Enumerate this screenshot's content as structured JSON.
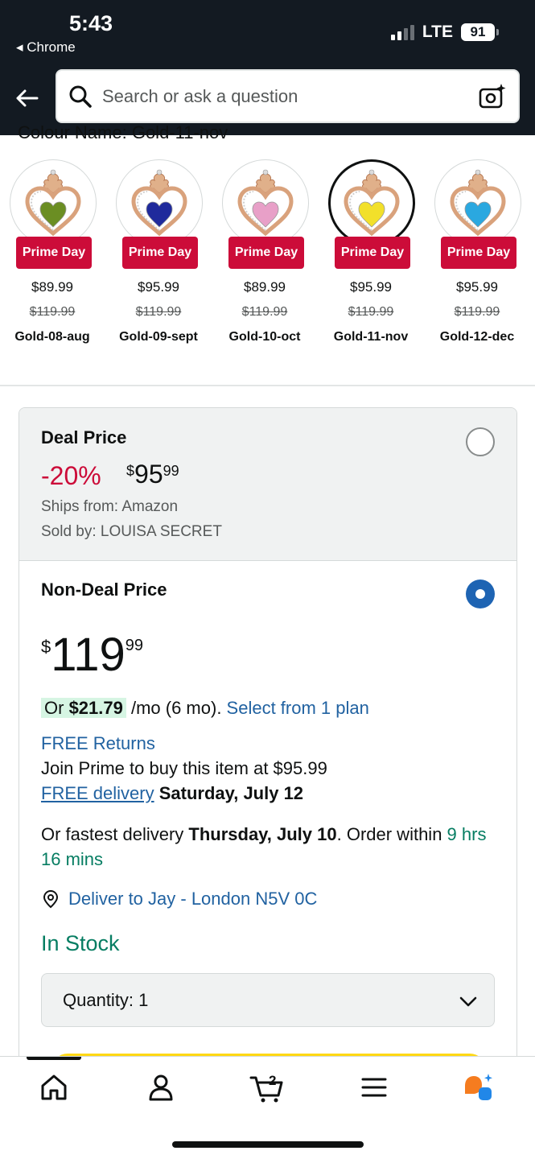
{
  "status_bar": {
    "time": "5:43",
    "back_app": "◂ Chrome",
    "network": "LTE",
    "battery": "91"
  },
  "search": {
    "placeholder": "Search or ask a question"
  },
  "colour_name_partial": "Colour Name: Gold-11-nov",
  "variants": [
    {
      "badge": "Prime Day",
      "price": "$89.99",
      "was": "$119.99",
      "name": "Gold-08-aug",
      "gem_color": "#6b8e23",
      "selected": false
    },
    {
      "badge": "Prime Day",
      "price": "$95.99",
      "was": "$119.99",
      "name": "Gold-09-sept",
      "gem_color": "#1f2a9c",
      "selected": false
    },
    {
      "badge": "Prime Day",
      "price": "$89.99",
      "was": "$119.99",
      "name": "Gold-10-oct",
      "gem_color": "#e8a0c8",
      "selected": false
    },
    {
      "badge": "Prime Day",
      "price": "$95.99",
      "was": "$119.99",
      "name": "Gold-11-nov",
      "gem_color": "#f2e02a",
      "selected": true
    },
    {
      "badge": "Prime Day",
      "price": "$95.99",
      "was": "$119.99",
      "name": "Gold-12-dec",
      "gem_color": "#2aa8e0",
      "selected": false
    }
  ],
  "deal": {
    "title": "Deal Price",
    "discount": "-20%",
    "currency": "$",
    "whole": "95",
    "fraction": "99",
    "ships_from": "Ships from: Amazon",
    "sold_by": "Sold by: LOUISA SECRET",
    "selected": false
  },
  "non_deal": {
    "title": "Non-Deal Price",
    "currency": "$",
    "whole": "119",
    "fraction": "99",
    "selected": true,
    "installment_prefix": "Or ",
    "installment_amount": "$21.79",
    "installment_suffix": " /mo (6 mo). ",
    "installment_link": "Select from 1 plan",
    "free_returns": "FREE Returns",
    "join_prime": "Join Prime to buy this item at $95.99",
    "free_delivery_link": "FREE delivery",
    "free_delivery_date": " Saturday, July 12",
    "fastest_prefix": "Or fastest delivery ",
    "fastest_date": "Thursday, July 10",
    "fastest_mid": ". Order within ",
    "fastest_time": "9 hrs 16 mins",
    "deliver_to": "Deliver to Jay - London N5V 0C",
    "stock": "In Stock",
    "quantity": "Quantity: 1"
  },
  "bottom_nav": {
    "items": [
      "home-icon",
      "account-icon",
      "cart-icon",
      "menu-icon",
      "rufus-icon"
    ],
    "cart_count": "2"
  },
  "colors": {
    "header_bg": "#131a22",
    "prime_day_red": "#cc0c39",
    "link_blue": "#2162a1",
    "in_stock_green": "#067d62",
    "radio_selected": "#1e64b3"
  }
}
